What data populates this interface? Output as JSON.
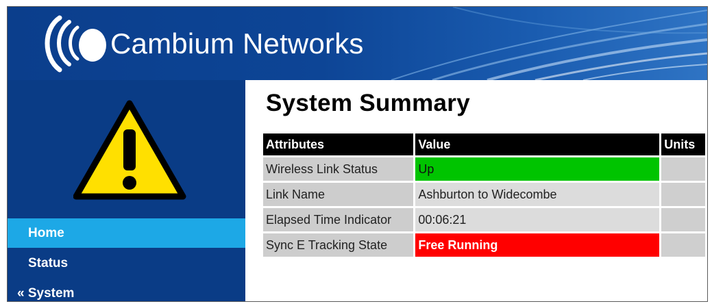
{
  "header": {
    "brand": "Cambium Networks"
  },
  "nav": {
    "items": [
      {
        "label": "Home"
      },
      {
        "label": "Status"
      },
      {
        "label": "« System"
      }
    ]
  },
  "page": {
    "title": "System Summary"
  },
  "table": {
    "headers": [
      "Attributes",
      "Value",
      "Units"
    ],
    "rows": [
      {
        "attribute": "Wireless Link Status",
        "value": "Up",
        "units": ""
      },
      {
        "attribute": "Link Name",
        "value": "Ashburton to Widecombe",
        "units": ""
      },
      {
        "attribute": "Elapsed Time Indicator",
        "value": "00:06:21",
        "units": ""
      },
      {
        "attribute": "Sync E Tracking State",
        "value": "Free Running",
        "units": ""
      }
    ]
  },
  "colors": {
    "header_blue": "#0b3e8c",
    "nav_blue": "#0a3c86",
    "nav_active": "#1da8e6",
    "status_ok": "#00c400",
    "status_bad": "#ff0000"
  },
  "icons": {
    "logo": "cambium-logo-icon",
    "warning": "warning-triangle-icon"
  }
}
